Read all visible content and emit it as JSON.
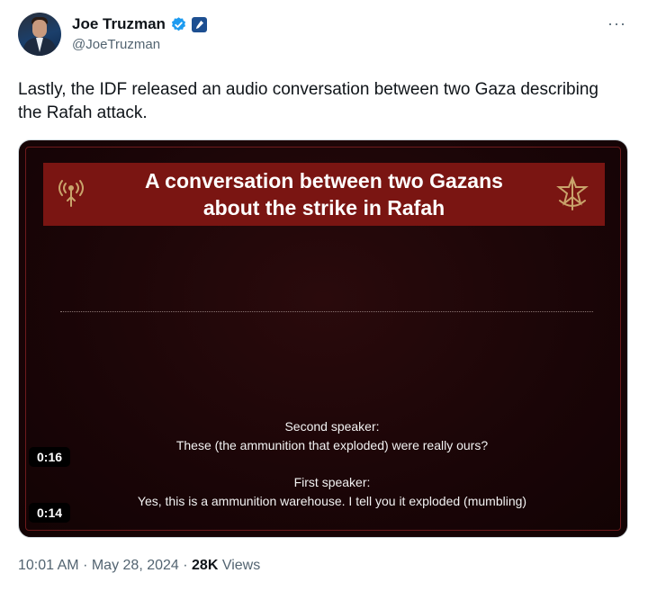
{
  "author": {
    "display_name": "Joe Truzman",
    "handle": "@JoeTruzman",
    "colors": {
      "verified": "#1d9bf0",
      "affiliation": "#1d4f91"
    }
  },
  "tweet": {
    "text": "Lastly, the IDF released an audio conversation between two Gaza describing the Rafah attack."
  },
  "media": {
    "banner_title": "A conversation between two Gazans about the strike in Rafah",
    "banner_color": "#7a1512",
    "captions": [
      {
        "speaker": "Second speaker:",
        "line": "These (the ammunition that exploded) were really ours?",
        "timestamp": "0:16"
      },
      {
        "speaker": "First speaker:",
        "line": "Yes, this is a ammunition warehouse. I tell you it exploded (mumbling)",
        "timestamp": "0:14"
      }
    ],
    "icons": [
      "signal-emblem-icon",
      "idf-emblem-icon"
    ]
  },
  "meta": {
    "time": "10:01 AM",
    "date": "May 28, 2024",
    "views_count": "28K",
    "views_label": "Views",
    "sep": "·"
  }
}
